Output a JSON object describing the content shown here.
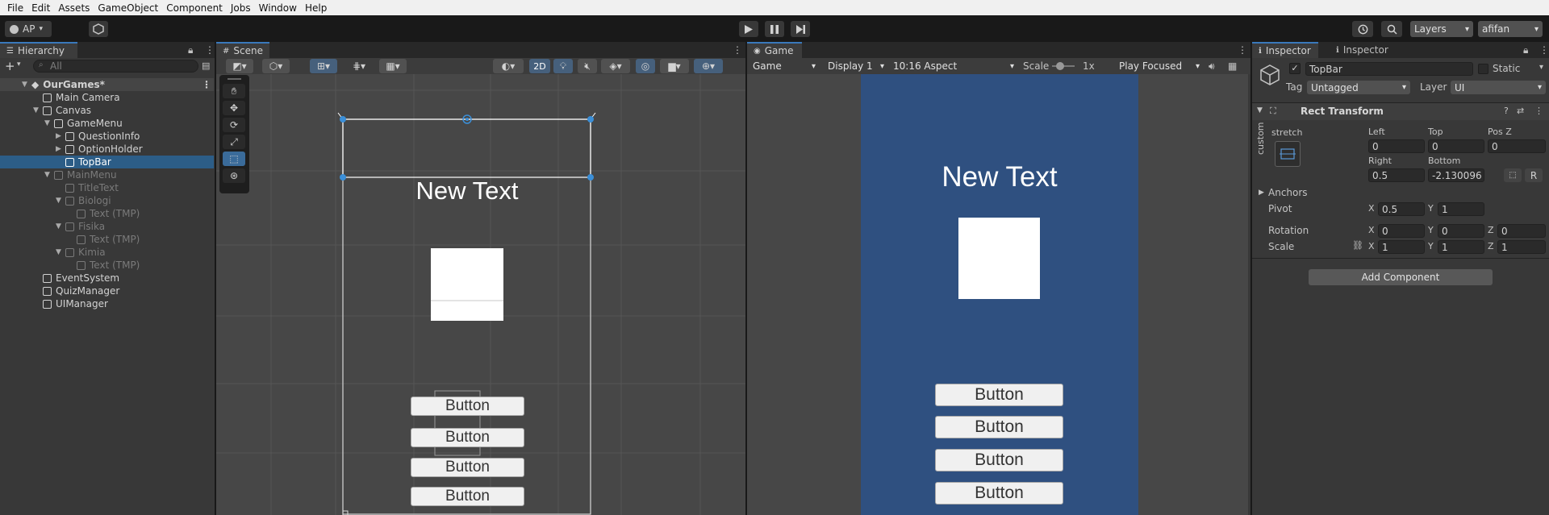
{
  "menu": [
    "File",
    "Edit",
    "Assets",
    "GameObject",
    "Component",
    "Jobs",
    "Window",
    "Help"
  ],
  "toolbar": {
    "account": "AP",
    "layers": "Layers",
    "user": "afifan"
  },
  "hierarchy": {
    "tab": "Hierarchy",
    "search_placeholder": "All",
    "items": [
      {
        "label": "OurGames*",
        "depth": 0,
        "expand": "open",
        "state": "scene"
      },
      {
        "label": "Main Camera",
        "depth": 1,
        "expand": "none",
        "state": "normal"
      },
      {
        "label": "Canvas",
        "depth": 1,
        "expand": "open",
        "state": "normal"
      },
      {
        "label": "GameMenu",
        "depth": 2,
        "expand": "open",
        "state": "normal"
      },
      {
        "label": "QuestionInfo",
        "depth": 3,
        "expand": "closed",
        "state": "normal"
      },
      {
        "label": "OptionHolder",
        "depth": 3,
        "expand": "closed",
        "state": "normal"
      },
      {
        "label": "TopBar",
        "depth": 3,
        "expand": "none",
        "state": "selected"
      },
      {
        "label": "MainMenu",
        "depth": 2,
        "expand": "open",
        "state": "dim"
      },
      {
        "label": "TitleText",
        "depth": 3,
        "expand": "none",
        "state": "dim"
      },
      {
        "label": "Biologi",
        "depth": 3,
        "expand": "open",
        "state": "dim"
      },
      {
        "label": "Text (TMP)",
        "depth": 4,
        "expand": "none",
        "state": "dim"
      },
      {
        "label": "Fisika",
        "depth": 3,
        "expand": "open",
        "state": "dim"
      },
      {
        "label": "Text (TMP)",
        "depth": 4,
        "expand": "none",
        "state": "dim"
      },
      {
        "label": "Kimia",
        "depth": 3,
        "expand": "open",
        "state": "dim"
      },
      {
        "label": "Text (TMP)",
        "depth": 4,
        "expand": "none",
        "state": "dim"
      },
      {
        "label": "EventSystem",
        "depth": 1,
        "expand": "none",
        "state": "normal"
      },
      {
        "label": "QuizManager",
        "depth": 1,
        "expand": "none",
        "state": "normal"
      },
      {
        "label": "UIManager",
        "depth": 1,
        "expand": "none",
        "state": "normal"
      }
    ]
  },
  "scene": {
    "tab": "Scene",
    "mode_2d": "2D",
    "canvas_text": "New Text",
    "buttons": [
      "Button",
      "Button",
      "Button",
      "Button"
    ]
  },
  "game": {
    "tab": "Game",
    "view": "Game",
    "display": "Display 1",
    "aspect": "10:16 Aspect",
    "scale_label": "Scale",
    "scale_value": "1x",
    "play_mode": "Play Focused",
    "canvas_text": "New Text",
    "buttons": [
      "Button",
      "Button",
      "Button",
      "Button"
    ],
    "bg_color": "#2f5080"
  },
  "inspector": {
    "tab1": "Inspector",
    "tab2": "Inspector",
    "object_name": "TopBar",
    "static": "Static",
    "tag_label": "Tag",
    "tag_value": "Untagged",
    "layer_label": "Layer",
    "layer_value": "UI",
    "component": "Rect Transform",
    "stretch": "stretch",
    "custom": "custom",
    "left_label": "Left",
    "left": "0",
    "top_label": "Top",
    "top": "0",
    "posz_label": "Pos Z",
    "posz": "0",
    "right_label": "Right",
    "right": "0.5",
    "bottom_label": "Bottom",
    "bottom": "-2.130096",
    "anchors": "Anchors",
    "pivot_label": "Pivot",
    "pivot_x": "0.5",
    "pivot_y": "1",
    "rotation_label": "Rotation",
    "rot_x": "0",
    "rot_y": "0",
    "rot_z": "0",
    "scale_label": "Scale",
    "scale_x": "1",
    "scale_y": "1",
    "scale_z": "1",
    "axis_x": "X",
    "axis_y": "Y",
    "axis_z": "Z",
    "reset": "R",
    "add_component": "Add Component"
  }
}
